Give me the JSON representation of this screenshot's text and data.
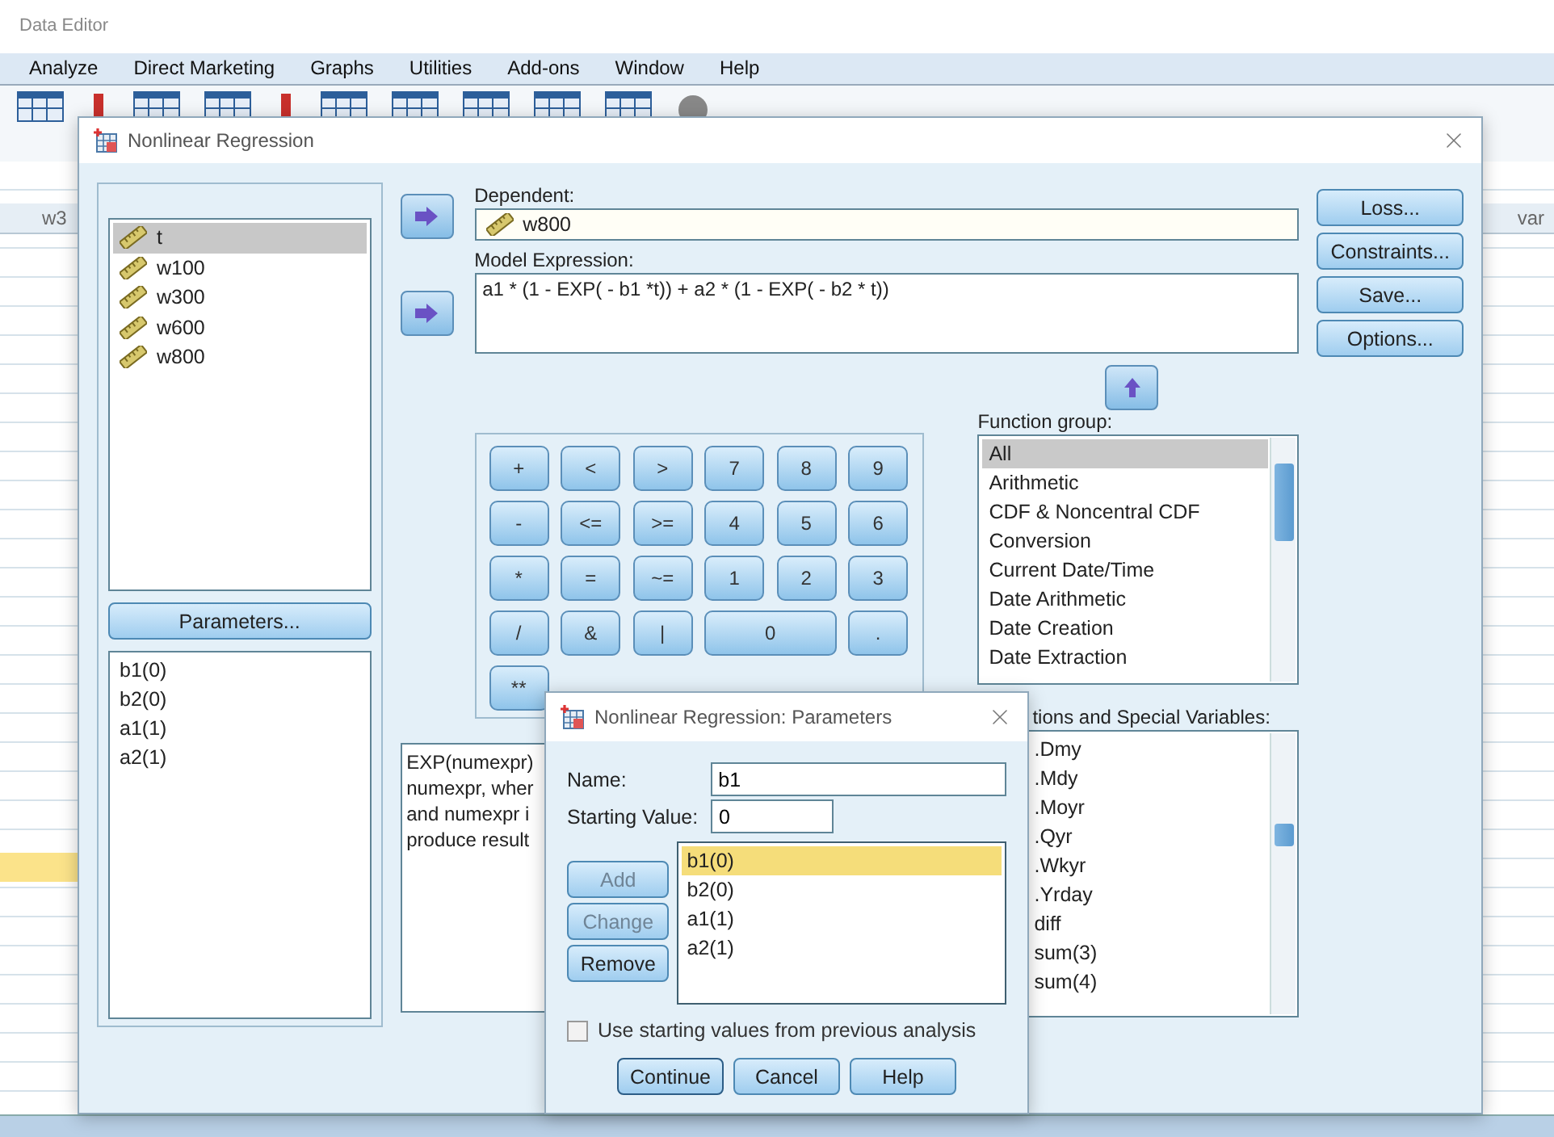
{
  "app": {
    "title": "Data Editor",
    "menu": [
      {
        "label": "Analyze"
      },
      {
        "label": "Direct Marketing"
      },
      {
        "label": "Graphs"
      },
      {
        "label": "Utilities"
      },
      {
        "label": "Add-ons"
      },
      {
        "label": "Window"
      },
      {
        "label": "Help"
      }
    ],
    "grid": {
      "left_header": "w3",
      "right_header": "var"
    }
  },
  "dialog": {
    "title": "Nonlinear Regression",
    "variables": [
      {
        "name": "t",
        "selected": true
      },
      {
        "name": "w100",
        "selected": false
      },
      {
        "name": "w300",
        "selected": false
      },
      {
        "name": "w600",
        "selected": false
      },
      {
        "name": "w800",
        "selected": false
      }
    ],
    "parameters_button": "Parameters...",
    "parameters": [
      "b1(0)",
      "b2(0)",
      "a1(1)",
      "a2(1)"
    ],
    "dependent": {
      "label": "Dependent:",
      "value": "w800"
    },
    "model_expression": {
      "label": "Model Expression:",
      "value": "a1 * (1 - EXP( - b1 *t)) + a2 * (1 - EXP( - b2 * t))"
    },
    "side_buttons": [
      "Loss...",
      "Constraints...",
      "Save...",
      "Options..."
    ],
    "keypad": [
      [
        {
          "label": "+",
          "kind": "key"
        },
        {
          "label": "<",
          "kind": "key"
        },
        {
          "label": ">",
          "kind": "key"
        },
        {
          "label": "7",
          "kind": "key"
        },
        {
          "label": "8",
          "kind": "key"
        },
        {
          "label": "9",
          "kind": "key"
        }
      ],
      [
        {
          "label": "-",
          "kind": "key"
        },
        {
          "label": "<=",
          "kind": "key"
        },
        {
          "label": ">=",
          "kind": "key"
        },
        {
          "label": "4",
          "kind": "key"
        },
        {
          "label": "5",
          "kind": "key"
        },
        {
          "label": "6",
          "kind": "key"
        }
      ],
      [
        {
          "label": "*",
          "kind": "key"
        },
        {
          "label": "=",
          "kind": "key"
        },
        {
          "label": "~=",
          "kind": "key"
        },
        {
          "label": "1",
          "kind": "key"
        },
        {
          "label": "2",
          "kind": "key"
        },
        {
          "label": "3",
          "kind": "key"
        }
      ],
      [
        {
          "label": "/",
          "kind": "key"
        },
        {
          "label": "&",
          "kind": "key"
        },
        {
          "label": "|",
          "kind": "key"
        },
        {
          "label": "0",
          "kind": "wide"
        },
        {
          "label": ".",
          "kind": "key"
        }
      ],
      [
        {
          "label": "**",
          "kind": "key"
        }
      ]
    ],
    "function_group": {
      "label": "Function group:",
      "items": [
        {
          "label": "All",
          "selected": true
        },
        {
          "label": "Arithmetic",
          "selected": false
        },
        {
          "label": "CDF & Noncentral CDF",
          "selected": false
        },
        {
          "label": "Conversion",
          "selected": false
        },
        {
          "label": "Current Date/Time",
          "selected": false
        },
        {
          "label": "Date Arithmetic",
          "selected": false
        },
        {
          "label": "Date Creation",
          "selected": false
        },
        {
          "label": "Date Extraction",
          "selected": false
        }
      ]
    },
    "description": [
      "EXP(numexpr)",
      "numexpr, wher",
      "and numexpr i",
      "produce result"
    ],
    "functions": {
      "label": "tions and Special Variables:",
      "items": [
        {
          "label": ".Dmy",
          "selected": false
        },
        {
          "label": ".Mdy",
          "selected": false
        },
        {
          "label": ".Moyr",
          "selected": false
        },
        {
          "label": ".Qyr",
          "selected": false
        },
        {
          "label": ".Wkyr",
          "selected": false
        },
        {
          "label": ".Yrday",
          "selected": false
        },
        {
          "label": "diff",
          "selected": false
        },
        {
          "label": "sum(3)",
          "selected": false
        },
        {
          "label": "sum(4)",
          "selected": false
        }
      ]
    }
  },
  "param_dialog": {
    "title": "Nonlinear Regression: Parameters",
    "name_label": "Name:",
    "name_value": "b1",
    "start_label": "Starting Value:",
    "start_value": "0",
    "buttons": [
      {
        "label": "Add",
        "disabled": true
      },
      {
        "label": "Change",
        "disabled": true
      },
      {
        "label": "Remove",
        "disabled": false
      }
    ],
    "list": [
      {
        "label": "b1(0)",
        "selected": true
      },
      {
        "label": "b2(0)",
        "selected": false
      },
      {
        "label": "a1(1)",
        "selected": false
      },
      {
        "label": "a2(1)",
        "selected": false
      }
    ],
    "use_previous": {
      "label": "Use starting values from previous analysis",
      "checked": false
    },
    "footer_buttons": [
      {
        "label": "Continue",
        "default": true
      },
      {
        "label": "Cancel",
        "default": false
      },
      {
        "label": "Help",
        "default": false
      }
    ]
  }
}
